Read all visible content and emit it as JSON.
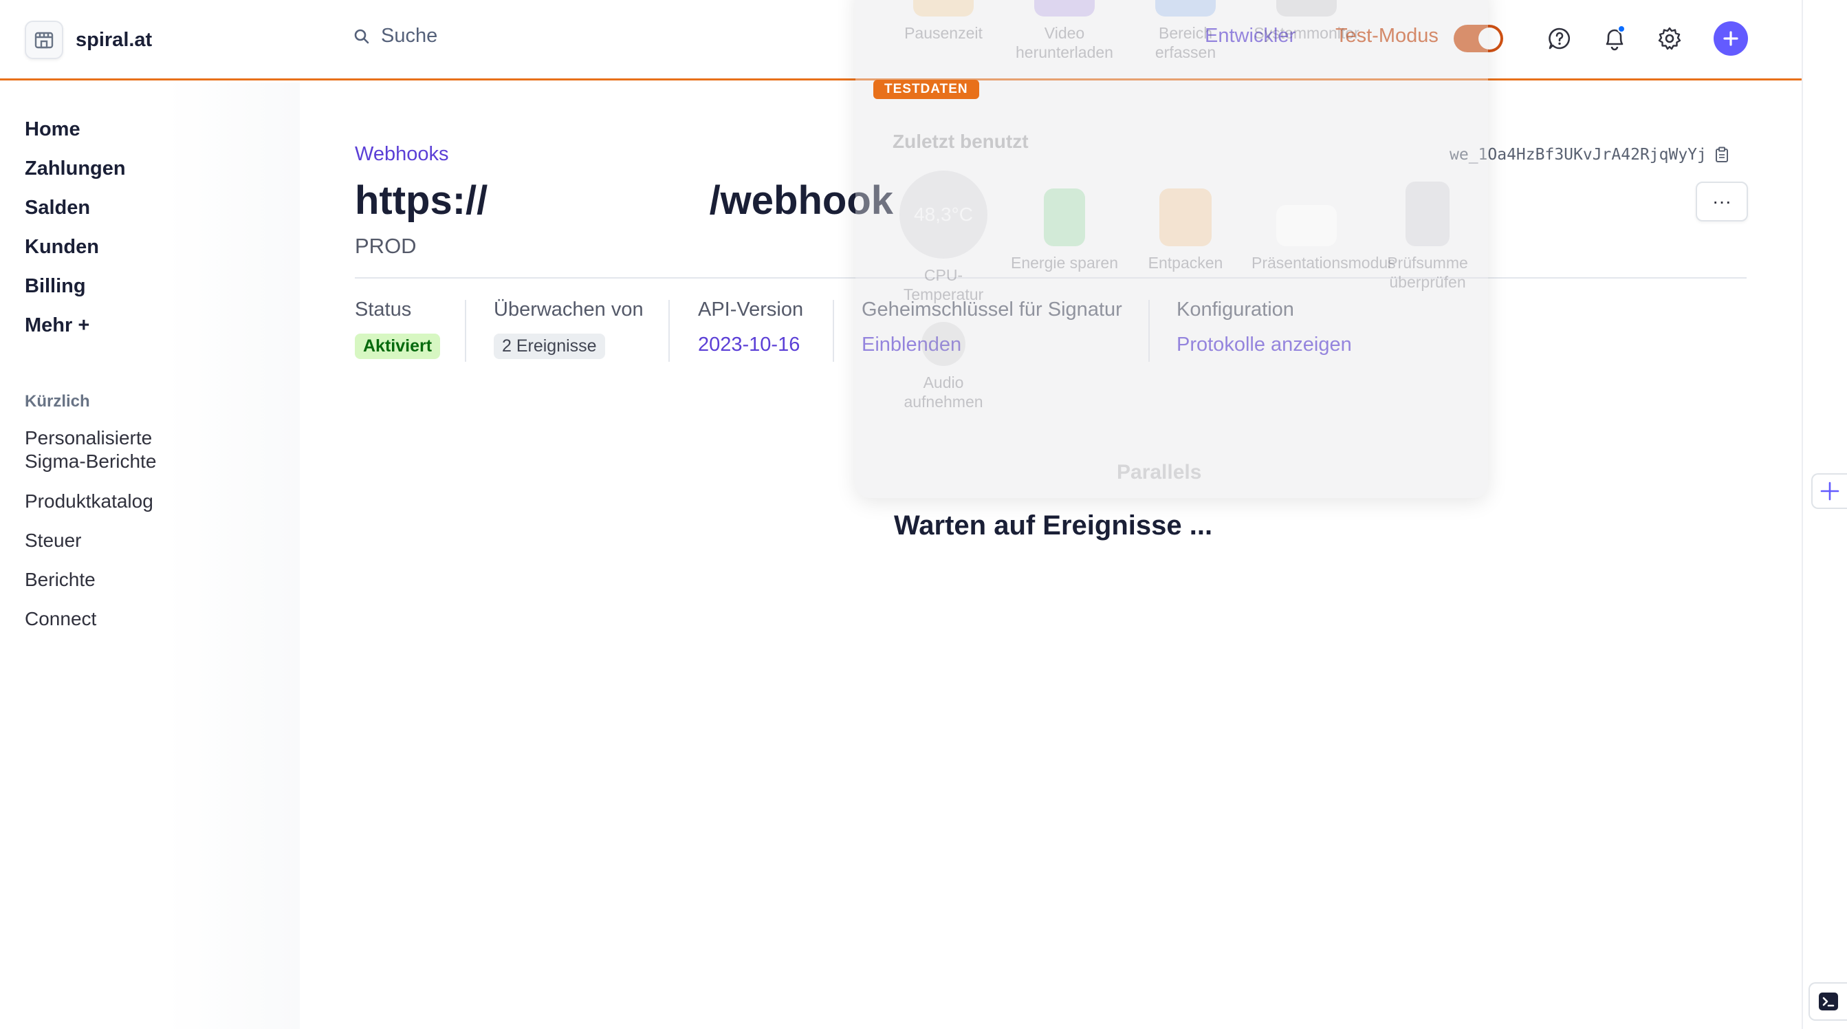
{
  "topbar": {
    "account_name": "spiral.at",
    "search_placeholder": "Suche",
    "developer_link": "Entwickler",
    "test_mode_label": "Test-Modus",
    "test_mode_on": true,
    "accent_color": "#635bff",
    "test_color": "#cf5114"
  },
  "sidebar": {
    "nav": [
      "Home",
      "Zahlungen",
      "Salden",
      "Kunden",
      "Billing",
      "Mehr +"
    ],
    "recent_label": "Kürzlich",
    "recent": [
      "Personalisierte Sigma-Berichte",
      "Produktkatalog",
      "Steuer",
      "Berichte",
      "Connect"
    ]
  },
  "main": {
    "breadcrumb": "Webhooks",
    "title": "https://                    /webhook",
    "subtitle": "PROD",
    "webhook_id": "we_1Oa4HzBf3UKvJrA42RjqWyYj",
    "more_label": "···",
    "meta": {
      "status_label": "Status",
      "status_value": "Aktiviert",
      "listening_label": "Überwachen von",
      "listening_value": "2 Ereignisse",
      "api_label": "API-Version",
      "api_value": "2023-10-16",
      "secret_label": "Geheimschlüssel für Signatur",
      "secret_value": "Einblenden",
      "config_label": "Konfiguration",
      "config_value": "Protokolle anzeigen"
    },
    "waiting_text": "Warten auf Ereignisse ..."
  },
  "overlay": {
    "testdata_badge": "TESTDATEN",
    "recent_heading": "Zuletzt benutzt",
    "top_tiles": [
      "Pausenzeit",
      "Video herunterladen",
      "Bereich erfassen",
      "Systemmonitor"
    ],
    "tiles": [
      "CPU-Temperatur",
      "Energie sparen",
      "Entpacken",
      "Präsentationsmodus",
      "Prüfsumme überprüfen"
    ],
    "cpu_temp": "48,3°C",
    "audio_tile": "Audio aufnehmen",
    "brand": "Parallels"
  }
}
